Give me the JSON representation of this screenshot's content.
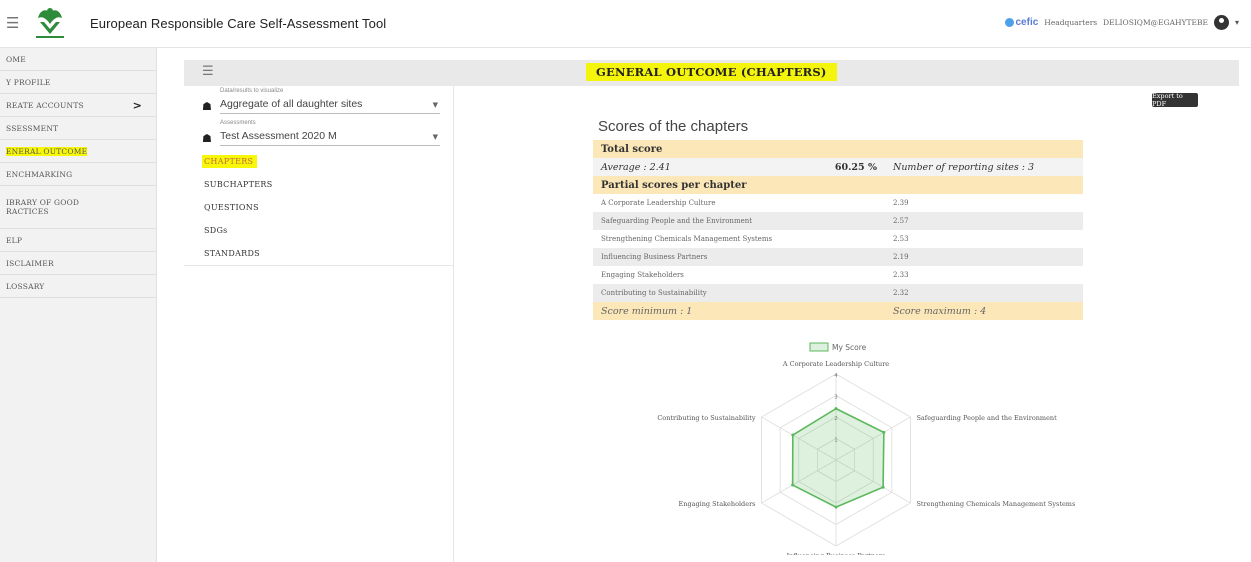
{
  "header": {
    "app_title": "European Responsible Care Self-Assessment Tool",
    "brand": "cefic",
    "site": "Headquarters",
    "user": "DELIOSIQM@EGAHYTEBE"
  },
  "sidebar": {
    "items": [
      {
        "label": "OME"
      },
      {
        "label": "Y PROFILE"
      },
      {
        "label": "REATE ACCOUNTS"
      },
      {
        "label": "SSESSMENT"
      },
      {
        "label": "ENERAL OUTCOME"
      },
      {
        "label": "ENCHMARKING"
      },
      {
        "label": "IBRARY OF GOOD RACTICES"
      },
      {
        "label": "ELP"
      },
      {
        "label": "ISCLAIMER"
      },
      {
        "label": "LOSSARY"
      }
    ]
  },
  "page_title": "GENERAL OUTCOME (CHAPTERS)",
  "filters": {
    "data_caption": "Data/results to visualize",
    "data_value": "Aggregate of all daughter sites",
    "assess_caption": "Assessments",
    "assess_value": "Test Assessment 2020 M"
  },
  "subnav": {
    "items": [
      {
        "label": "CHAPTERS"
      },
      {
        "label": "SUBCHAPTERS"
      },
      {
        "label": "QUESTIONS"
      },
      {
        "label": "SDGs"
      },
      {
        "label": "STANDARDS"
      }
    ]
  },
  "export_label": "Export to PDF",
  "scores": {
    "title": "Scores of the chapters",
    "total_label": "Total score",
    "average": "Average : 2.41",
    "percent": "60.25 %",
    "sites": "Number of reporting sites : 3",
    "partial_label": "Partial scores per chapter",
    "rows": [
      {
        "name": "A Corporate Leadership Culture",
        "score": "2.39"
      },
      {
        "name": "Safeguarding People and the Environment",
        "score": "2.57"
      },
      {
        "name": "Strengthening Chemicals Management Systems",
        "score": "2.53"
      },
      {
        "name": "Influencing Business Partners",
        "score": "2.19"
      },
      {
        "name": "Engaging Stakeholders",
        "score": "2.33"
      },
      {
        "name": "Contributing to Sustainability",
        "score": "2.32"
      }
    ],
    "min": "Score minimum : 1",
    "max": "Score maximum : 4"
  },
  "chart_data": {
    "type": "radar",
    "series": [
      {
        "name": "My Score",
        "values": [
          2.39,
          2.57,
          2.53,
          2.19,
          2.33,
          2.32
        ]
      }
    ],
    "categories": [
      "A Corporate Leadership Culture",
      "Safeguarding People and the Environment",
      "Strengthening Chemicals Management Systems",
      "Influencing Business Partners",
      "Engaging Stakeholders",
      "Contributing to Sustainability"
    ],
    "rlim": [
      0,
      4
    ],
    "ticks": [
      "1",
      "2",
      "3",
      "4"
    ],
    "legend": "top",
    "color": "#5cb85c"
  }
}
